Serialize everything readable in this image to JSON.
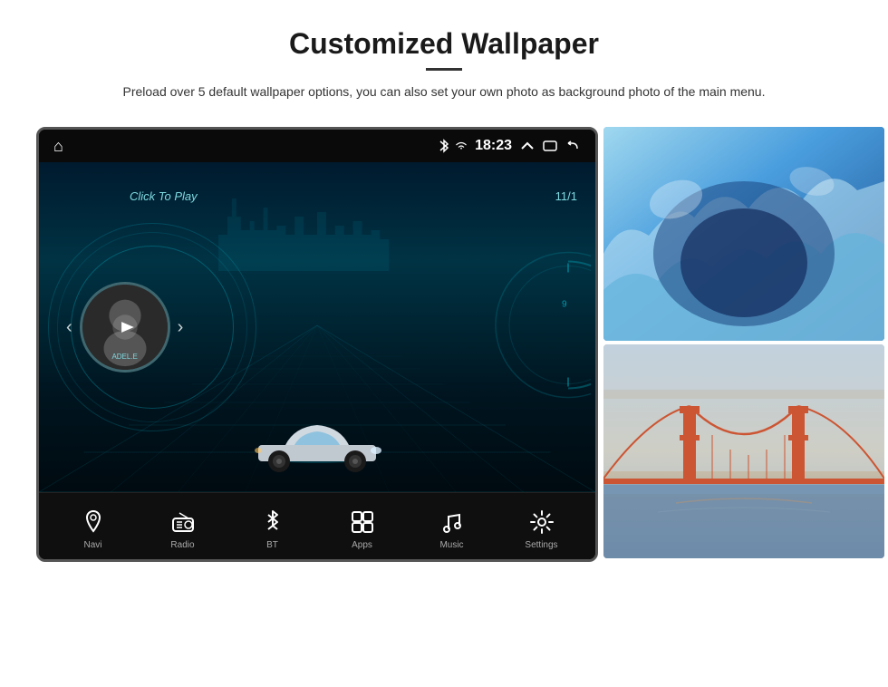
{
  "header": {
    "title": "Customized Wallpaper",
    "description": "Preload over 5 default wallpaper options, you can also set your own photo as background photo of the main menu."
  },
  "device": {
    "status_bar": {
      "time": "18:23",
      "home_icon": "⌂",
      "bt_icon": "bluetooth",
      "wifi_icon": "wifi",
      "up_icon": "∧",
      "window_icon": "⬜",
      "back_icon": "↩"
    },
    "main_screen": {
      "click_to_play": "Click To Play",
      "date": "11/1",
      "album_name": "ADEL.E",
      "car_label": "car"
    },
    "nav_bar": {
      "items": [
        {
          "label": "Navi",
          "icon": "location-pin"
        },
        {
          "label": "Radio",
          "icon": "radio"
        },
        {
          "label": "BT",
          "icon": "bluetooth"
        },
        {
          "label": "Apps",
          "icon": "apps-grid"
        },
        {
          "label": "Music",
          "icon": "music-note"
        },
        {
          "label": "Settings",
          "icon": "gear"
        }
      ]
    }
  },
  "wallpapers": [
    {
      "label": "ice-cave",
      "type": "ice"
    },
    {
      "label": "golden-gate-bridge",
      "type": "bridge"
    }
  ]
}
